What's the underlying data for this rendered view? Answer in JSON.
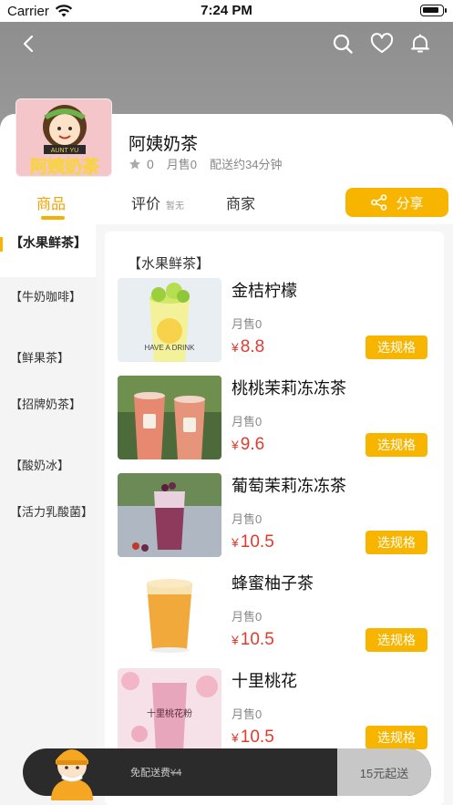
{
  "status_bar": {
    "carrier": "Carrier",
    "time": "7:24 PM"
  },
  "store": {
    "logo_text": "阿姨奶茶",
    "logo_subtext": "AUNT YU",
    "name": "阿姨奶茶",
    "rating": "0",
    "monthly_sales": "月售0",
    "delivery_time": "配送约34分钟"
  },
  "tabs": {
    "products": "商品",
    "reviews": "评价",
    "reviews_sub": "暂无",
    "merchant": "商家",
    "share": "分享"
  },
  "categories": [
    "【水果鲜茶】",
    "【牛奶咖啡】",
    "【鲜果茶】",
    "【招牌奶茶】",
    "【酸奶冰】",
    "【活力乳酸菌】"
  ],
  "section_title": "【水果鲜茶】",
  "items": [
    {
      "name": "金桔柠檬",
      "sales": "月售0",
      "price": "8.8",
      "button": "选规格",
      "image_text": "HAVE A DRINK"
    },
    {
      "name": "桃桃茉莉冻冻茶",
      "sales": "月售0",
      "price": "9.6",
      "button": "选规格"
    },
    {
      "name": "葡萄茉莉冻冻茶",
      "sales": "月售0",
      "price": "10.5",
      "button": "选规格"
    },
    {
      "name": "蜂蜜柚子茶",
      "sales": "月售0",
      "price": "10.5",
      "button": "选规格"
    },
    {
      "name": "十里桃花",
      "sales": "月售0",
      "price": "10.5",
      "button": "选规格",
      "image_text": "十里桃花粉"
    }
  ],
  "currency": "¥",
  "cart": {
    "delivery_label": "免配送费",
    "delivery_original": "¥4",
    "checkout_label": "15元起送"
  },
  "colors": {
    "accent": "#f7b500",
    "price": "#e23b2e",
    "tab_active": "#f2a200"
  }
}
